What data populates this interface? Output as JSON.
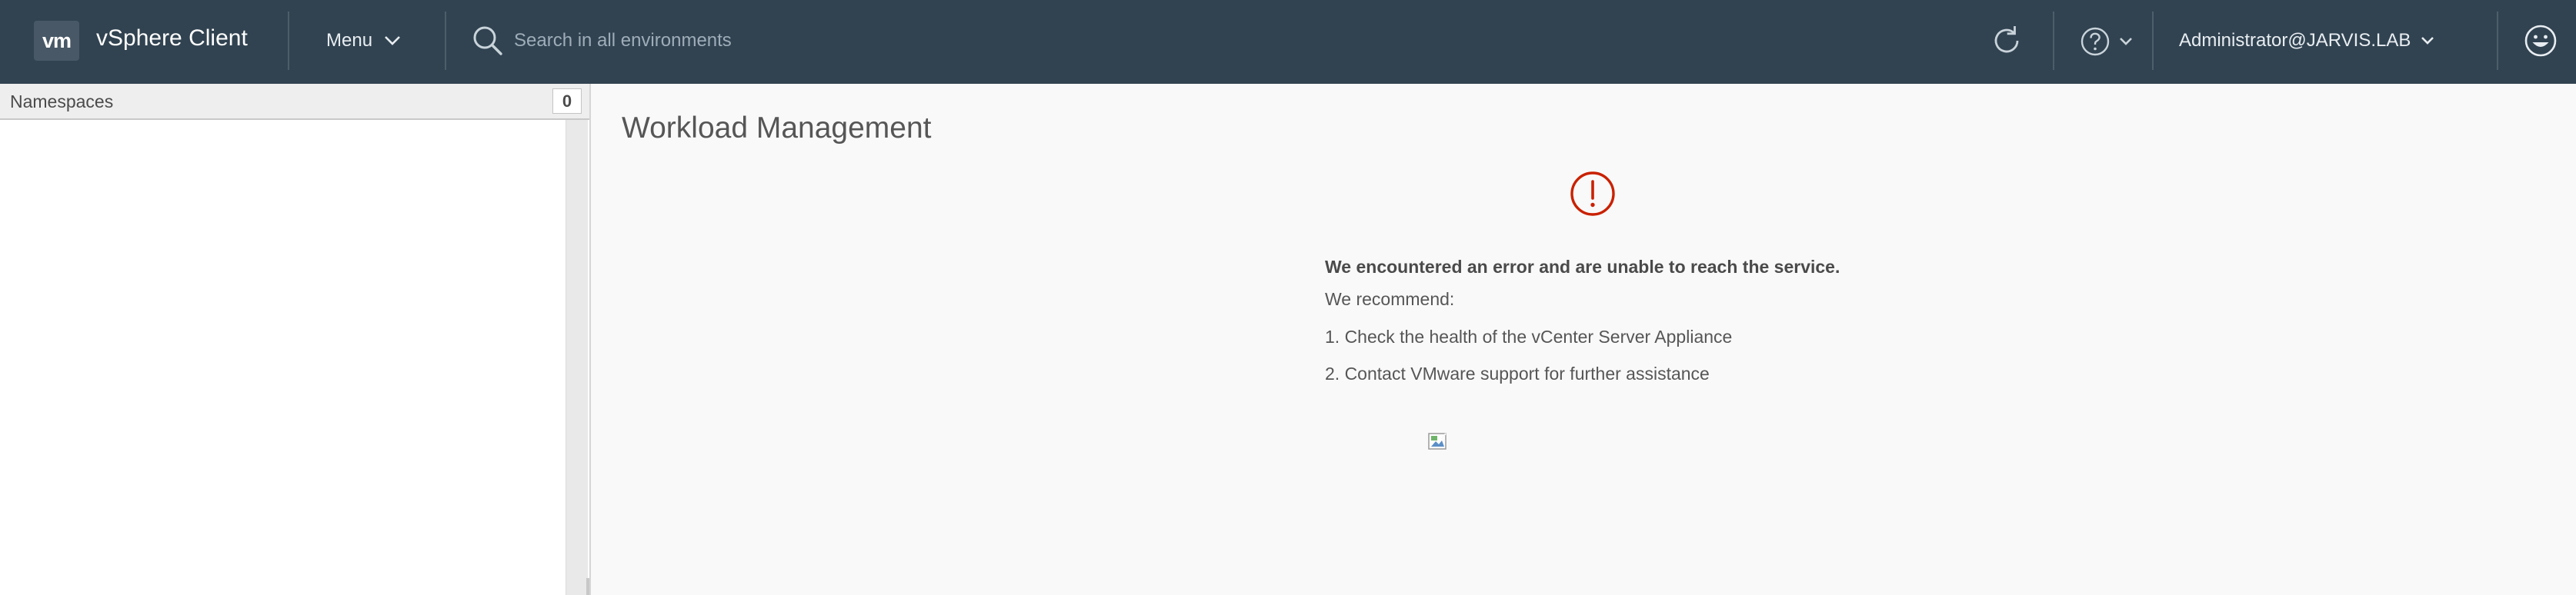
{
  "header": {
    "logo_text": "vm",
    "app_title": "vSphere Client",
    "menu_label": "Menu",
    "search_placeholder": "Search in all environments",
    "user_label": "Administrator@JARVIS.LAB",
    "icons": [
      "search-icon",
      "refresh-icon",
      "help-icon",
      "chevron-down-icon",
      "smiley-icon"
    ],
    "background_color": "#314351"
  },
  "left_panel": {
    "title": "Namespaces",
    "count": "0"
  },
  "main": {
    "page_title": "Workload Management",
    "error": {
      "icon": "error-icon",
      "icon_color": "#c92100",
      "heading": "We encountered an error and are unable to reach the service.",
      "recommend_label": "We recommend:",
      "steps": [
        "1. Check the health of the vCenter Server Appliance",
        "2. Contact VMware support for further assistance"
      ],
      "image_icon": "broken-image-icon"
    }
  }
}
